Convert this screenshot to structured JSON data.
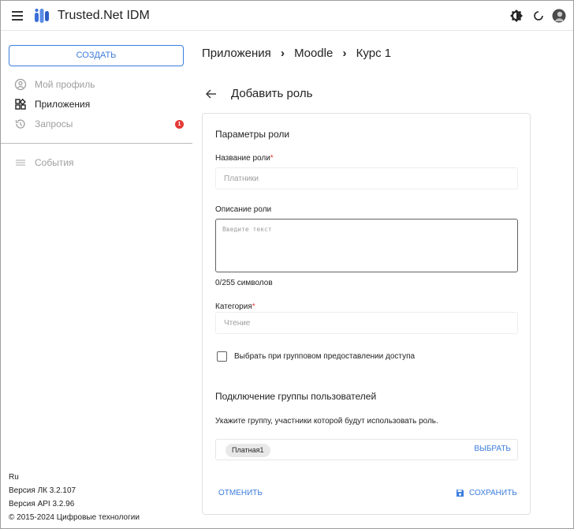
{
  "app": {
    "title": "Trusted.Net IDM",
    "menu_icon": "hamburger-menu-icon",
    "logo_icon": "trusted-net-logo-icon"
  },
  "header": {
    "icons": [
      "brightness-icon",
      "loading-icon",
      "user-avatar-icon"
    ]
  },
  "sidebar": {
    "create_label": "СОЗДАТЬ",
    "items": [
      {
        "label": "Мой профиль",
        "icon": "profile-icon"
      },
      {
        "label": "Приложения",
        "icon": "apps-icon"
      },
      {
        "label": "Запросы",
        "icon": "history-icon",
        "badge": "1"
      },
      {
        "label": "События",
        "icon": "list-icon"
      }
    ],
    "footer": {
      "lang": "Ru",
      "lk_version": "Версия ЛК 3.2.107",
      "api_version": "Версия API 3.2.96",
      "copyright": "© 2015-2024 Цифровые технологии"
    }
  },
  "breadcrumb": {
    "items": [
      "Приложения",
      "Moodle",
      "Курс 1"
    ],
    "separator": "›"
  },
  "page": {
    "title": "Добавить роль",
    "back_icon": "arrow-left-icon"
  },
  "form": {
    "section_params": "Параметры роли",
    "role_name_label": "Название роли",
    "role_name_placeholder": "Платники",
    "required_mark": "*",
    "description_label": "Описание роли",
    "description_placeholder": "Введите текст",
    "description_counter": "0/255 символов",
    "category_label": "Категория",
    "category_placeholder": "Чтение",
    "group_checkbox_label": "Выбрать при групповом предоставлении доступа",
    "section_group": "Подключение группы пользователей",
    "group_hint": "Укажите группу, участники которой будут использовать роль.",
    "group_chip": "Платная1",
    "select_label": "ВЫБРАТЬ",
    "cancel_label": "ОТМЕНИТЬ",
    "save_label": "СОХРАНИТЬ",
    "save_icon": "floppy-disk-icon"
  },
  "colors": {
    "accent": "#3b7ddd",
    "badge": "#e53935",
    "required": "#e53935"
  }
}
